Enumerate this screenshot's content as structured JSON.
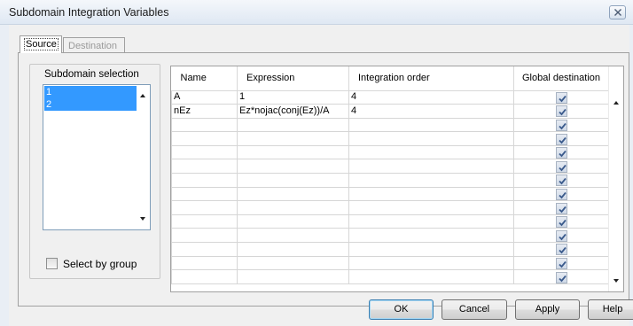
{
  "window": {
    "title": "Subdomain Integration Variables",
    "close_icon": "close-icon"
  },
  "tabs": [
    {
      "label": "Source",
      "active": true
    },
    {
      "label": "Destination",
      "active": false,
      "disabled": true
    }
  ],
  "subdomain_selection": {
    "label": "Subdomain selection",
    "items": [
      "1",
      "2"
    ],
    "selected": [
      "1",
      "2"
    ]
  },
  "select_by_group": {
    "label": "Select by group",
    "checked": false
  },
  "grid": {
    "columns": [
      "Name",
      "Expression",
      "Integration order",
      "Global destination"
    ],
    "rows": [
      {
        "name": "A",
        "expression": "1",
        "order": "4",
        "global": true
      },
      {
        "name": "nEz",
        "expression": "Ez*nojac(conj(Ez))/A",
        "order": "4",
        "global": true
      },
      {
        "name": "",
        "expression": "",
        "order": "",
        "global": true
      },
      {
        "name": "",
        "expression": "",
        "order": "",
        "global": true
      },
      {
        "name": "",
        "expression": "",
        "order": "",
        "global": true
      },
      {
        "name": "",
        "expression": "",
        "order": "",
        "global": true
      },
      {
        "name": "",
        "expression": "",
        "order": "",
        "global": true
      },
      {
        "name": "",
        "expression": "",
        "order": "",
        "global": true
      },
      {
        "name": "",
        "expression": "",
        "order": "",
        "global": true
      },
      {
        "name": "",
        "expression": "",
        "order": "",
        "global": true
      },
      {
        "name": "",
        "expression": "",
        "order": "",
        "global": true
      },
      {
        "name": "",
        "expression": "",
        "order": "",
        "global": true
      },
      {
        "name": "",
        "expression": "",
        "order": "",
        "global": true
      },
      {
        "name": "",
        "expression": "",
        "order": "",
        "global": true
      }
    ]
  },
  "buttons": {
    "ok": "OK",
    "cancel": "Cancel",
    "apply": "Apply",
    "help": "Help"
  },
  "colors": {
    "selection": "#3399ff",
    "dialog_bg": "#f0f0f0",
    "check_mark": "#3a5a8c"
  }
}
